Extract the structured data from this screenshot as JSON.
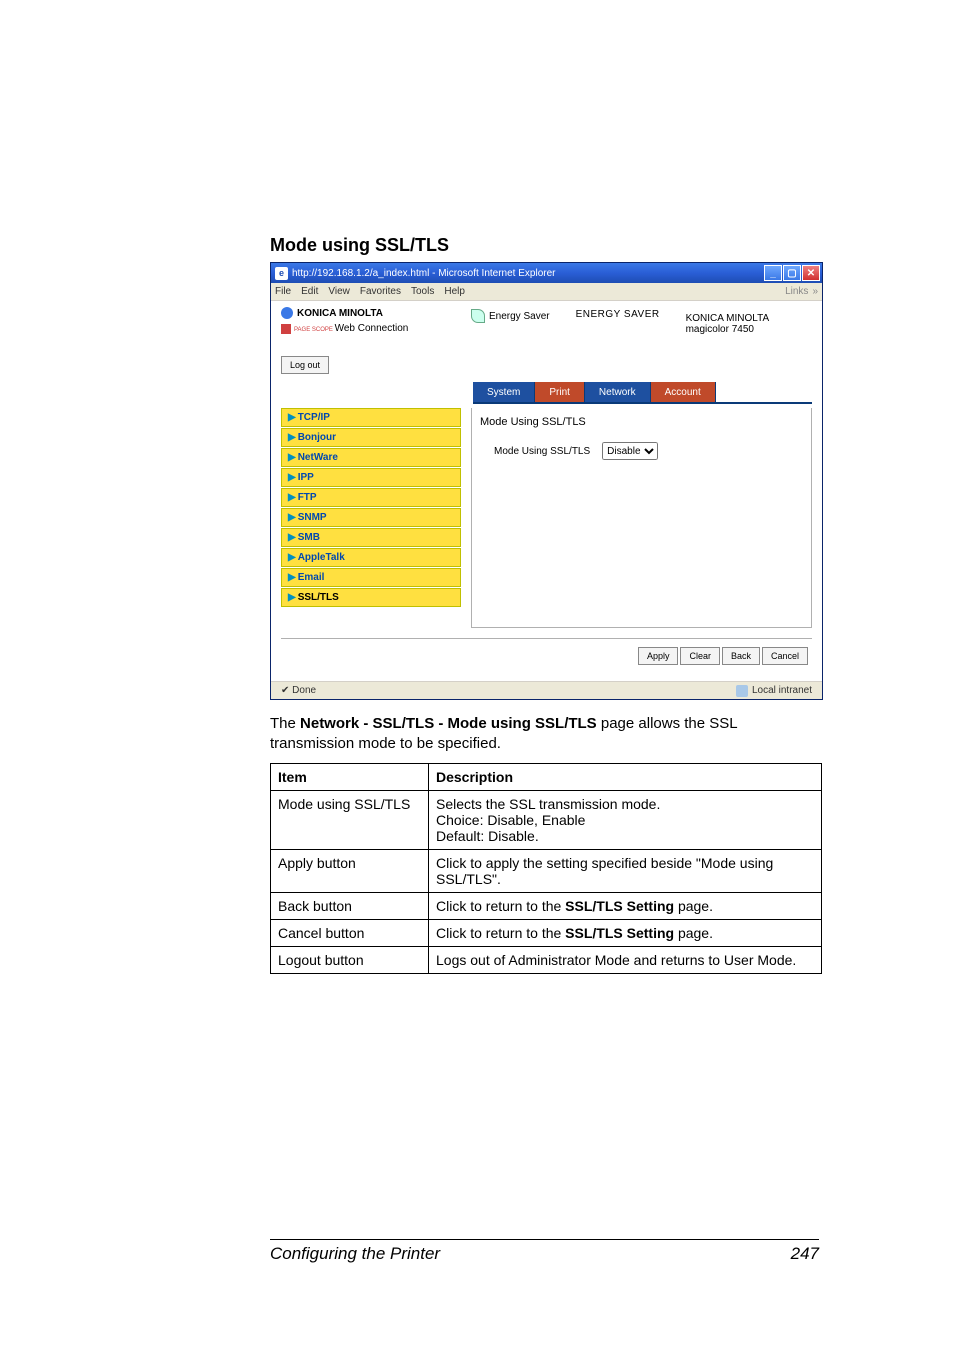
{
  "section_heading": "Mode using SSL/TLS",
  "browser": {
    "title": "http://192.168.1.2/a_index.html - Microsoft Internet Explorer",
    "menus": [
      "File",
      "Edit",
      "View",
      "Favorites",
      "Tools",
      "Help"
    ],
    "links_label": "Links",
    "brand": "KONICA MINOLTA",
    "pagescope": "Web Connection",
    "logout": "Log out",
    "energy_saver": "Energy Saver",
    "energy_title": "ENERGY SAVER",
    "model_line1": "KONICA MINOLTA",
    "model_line2": "magicolor 7450",
    "tabs": {
      "system": "System",
      "print": "Print",
      "network": "Network",
      "account": "Account"
    },
    "sidebar": [
      "TCP/IP",
      "Bonjour",
      "NetWare",
      "IPP",
      "FTP",
      "SNMP",
      "SMB",
      "AppleTalk",
      "Email",
      "SSL/TLS"
    ],
    "panel_title": "Mode Using SSL/TLS",
    "panel_field_label": "Mode Using SSL/TLS",
    "panel_select_value": "Disable",
    "buttons": {
      "apply": "Apply",
      "clear": "Clear",
      "back": "Back",
      "cancel": "Cancel"
    },
    "status_done": "Done",
    "status_zone": "Local intranet"
  },
  "paragraph_before": "The ",
  "paragraph_bold": "Network - SSL/TLS - Mode using SSL/TLS",
  "paragraph_after": " page allows the SSL transmission mode to be specified.",
  "table": {
    "header": {
      "item": "Item",
      "desc": "Description"
    },
    "rows": [
      {
        "item": "Mode using SSL/TLS",
        "desc": "Selects the SSL transmission mode.\nChoice:  Disable, Enable\nDefault:  Disable."
      },
      {
        "item": "Apply button",
        "desc": "Click to apply the setting specified beside \"Mode using SSL/TLS\"."
      },
      {
        "item": "Back button",
        "desc_before": "Click to return to the ",
        "desc_bold": "SSL/TLS Setting",
        "desc_after": " page."
      },
      {
        "item": "Cancel button",
        "desc_before": "Click to return to the ",
        "desc_bold": "SSL/TLS Setting",
        "desc_after": " page."
      },
      {
        "item": "Logout button",
        "desc": "Logs out of Administrator Mode and returns to User Mode."
      }
    ]
  },
  "footer": {
    "left": "Configuring the Printer",
    "right": "247"
  }
}
